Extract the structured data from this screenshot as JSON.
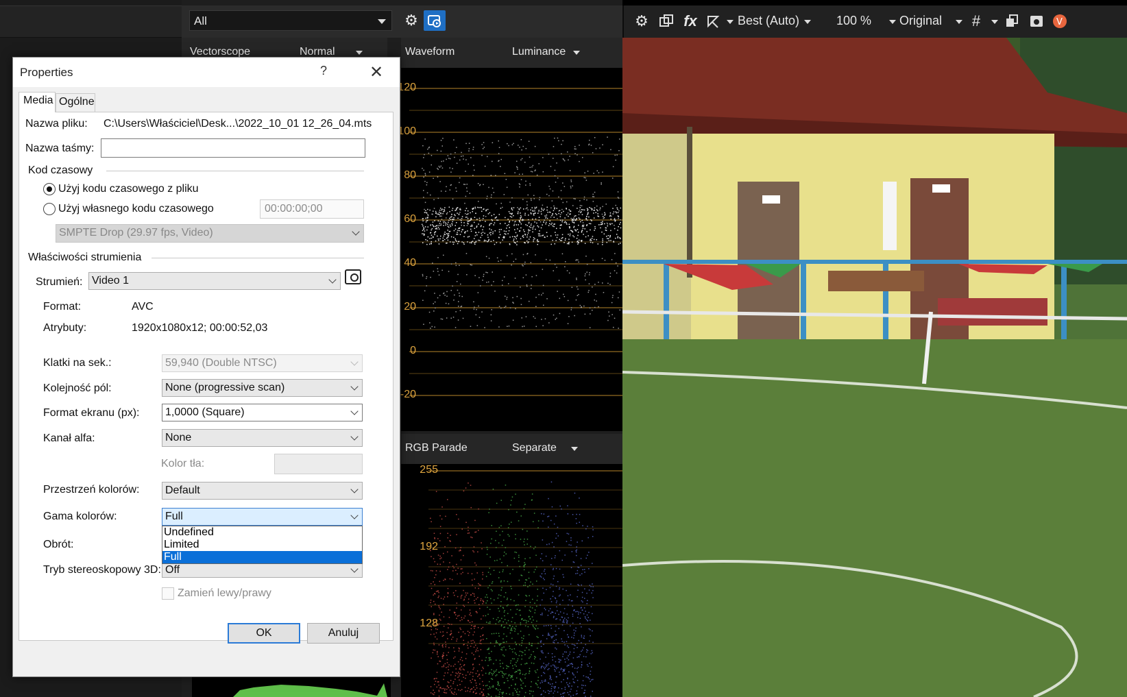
{
  "toolbar_left": {
    "filter_value": "All"
  },
  "scopes": {
    "vectorscope": {
      "title": "Vectorscope",
      "mode": "Normal"
    },
    "waveform": {
      "title": "Waveform",
      "mode": "Luminance",
      "ticks": [
        "120",
        "100",
        "80",
        "60",
        "40",
        "20",
        "0",
        "-20"
      ]
    },
    "rgb_parade": {
      "title": "RGB Parade",
      "mode": "Separate",
      "ticks": [
        "255",
        "192",
        "128"
      ]
    }
  },
  "preview_toolbar": {
    "quality": "Best (Auto)",
    "zoom": "100 %",
    "view": "Original",
    "icons": [
      "gear-icon",
      "split-screen-icon",
      "fx-icon",
      "overlay-icon",
      "grid-icon",
      "copy-frame-icon",
      "save-snapshot-icon",
      "vegas-logo-icon"
    ]
  },
  "dialog": {
    "title": "Properties",
    "help": "?",
    "tabs": [
      {
        "label": "Media"
      },
      {
        "label": "Ogólne"
      }
    ],
    "file_name_label": "Nazwa pliku:",
    "file_name_value": "C:\\Users\\Właściciel\\Desk...\\2022_10_01 12_26_04.mts",
    "tape_name_label": "Nazwa taśmy:",
    "tape_name_value": "",
    "timecode_group": "Kod czasowy",
    "timecode_from_file": "Użyj kodu czasowego z pliku",
    "timecode_custom": "Użyj własnego kodu czasowego",
    "timecode_value": "00:00:00;00",
    "timecode_format": "SMPTE Drop (29.97 fps, Video)",
    "stream_group": "Właściwości strumienia",
    "stream_label": "Strumień:",
    "stream_value": "Video 1",
    "format_label": "Format:",
    "format_value": "AVC",
    "attributes_label": "Atrybuty:",
    "attributes_value": "1920x1080x12; 00:00:52,03",
    "fps_label": "Klatki na sek.:",
    "fps_value": "59,940 (Double NTSC)",
    "field_order_label": "Kolejność pól:",
    "field_order_value": "None (progressive scan)",
    "pixel_aspect_label": "Format ekranu (px):",
    "pixel_aspect_value": "1,0000 (Square)",
    "alpha_label": "Kanał alfa:",
    "alpha_value": "None",
    "bg_color_label": "Kolor tła:",
    "color_space_label": "Przestrzeń kolorów:",
    "color_space_value": "Default",
    "color_range_label": "Gama kolorów:",
    "color_range_value": "Full",
    "color_range_options": [
      "Undefined",
      "Limited",
      "Full"
    ],
    "rotation_label": "Obrót:",
    "stereo_label": "Tryb stereoskopowy 3D:",
    "stereo_value": "Off",
    "swap_label": "Zamień lewy/prawy",
    "ok": "OK",
    "cancel": "Anuluj"
  }
}
